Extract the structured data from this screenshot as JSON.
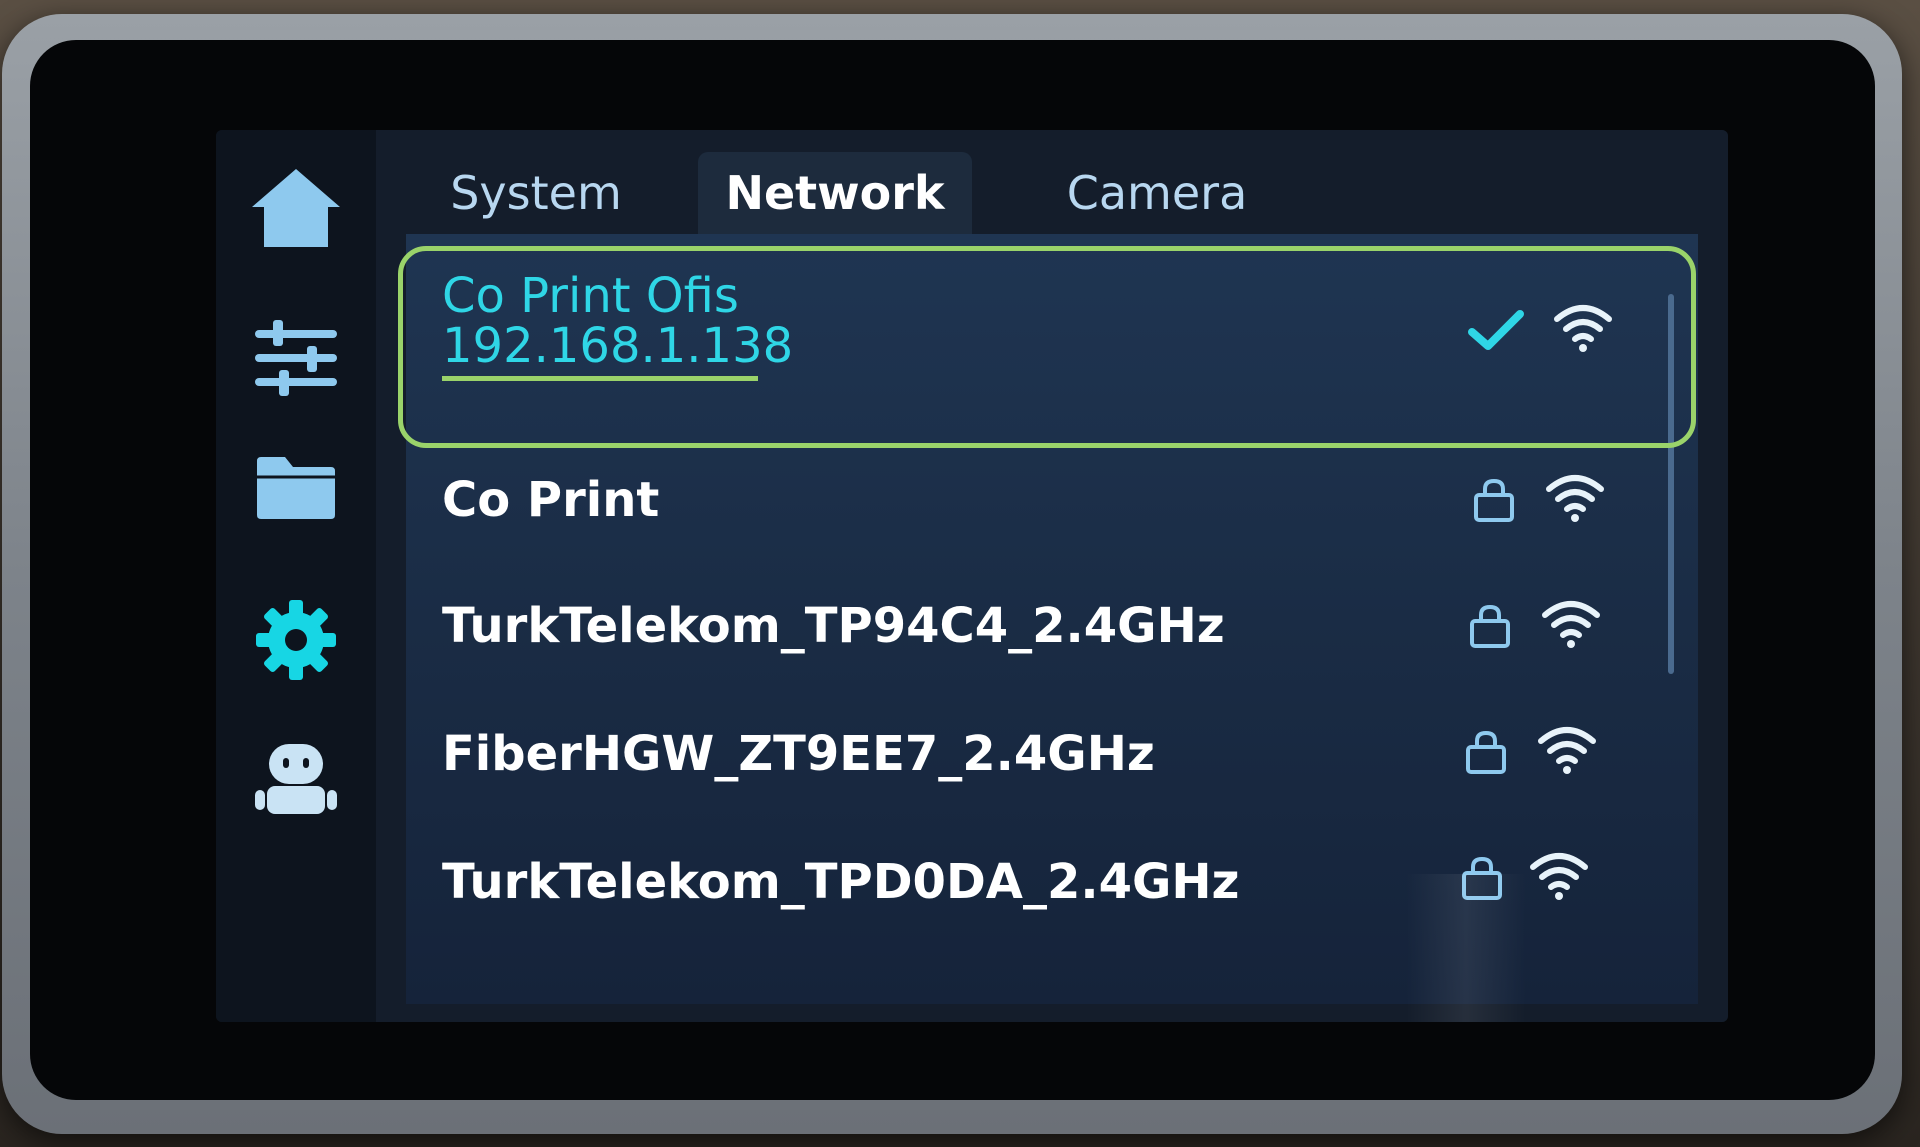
{
  "sidebar": {
    "items": [
      {
        "icon": "home-icon",
        "color": "#8ec9ee"
      },
      {
        "icon": "sliders-icon",
        "color": "#8ec9ee"
      },
      {
        "icon": "folder-icon",
        "color": "#8ec9ee"
      },
      {
        "icon": "gear-icon",
        "color": "#17d6e4",
        "active": true
      },
      {
        "icon": "robot-icon",
        "color": "#c9e3f4"
      }
    ]
  },
  "tabs": [
    {
      "label": "System"
    },
    {
      "label": "Network",
      "active": true
    },
    {
      "label": "Camera"
    }
  ],
  "networks": [
    {
      "ssid": "Co Print Ofis",
      "ip": "192.168.1.138",
      "connected": true,
      "status_icon": "checkmark-icon"
    },
    {
      "ssid": "Co Print",
      "status_icon": "lock-icon"
    },
    {
      "ssid": "TurkTelekom_TP94C4_2.4GHz",
      "status_icon": "lock-icon"
    },
    {
      "ssid": "FiberHGW_ZT9EE7_2.4GHz",
      "status_icon": "lock-icon"
    },
    {
      "ssid": "TurkTelekom_TPD0DA_2.4GHz",
      "status_icon": "lock-icon"
    }
  ],
  "colors": {
    "accent": "#2fd6e6",
    "highlight_outline": "#9ad36a",
    "icon_blue": "#8ec9ee"
  }
}
